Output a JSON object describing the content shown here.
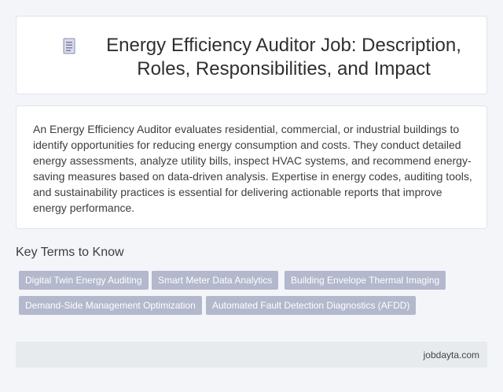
{
  "header": {
    "icon": "document-icon",
    "title": "Energy Efficiency Auditor Job: Description, Roles, Responsibilities, and Impact"
  },
  "description": "An Energy Efficiency Auditor evaluates residential, commercial, or industrial buildings to identify opportunities for reducing energy consumption and costs. They conduct detailed energy assessments, analyze utility bills, inspect HVAC systems, and recommend energy-saving measures based on data-driven analysis. Expertise in energy codes, auditing tools, and sustainability practices is essential for delivering actionable reports that improve energy performance.",
  "key_terms": {
    "heading": "Key Terms to Know",
    "tags": [
      "Digital Twin Energy Auditing",
      "Smart Meter Data Analytics",
      "Building Envelope Thermal Imaging",
      "Demand-Side Management Optimization",
      "Automated Fault Detection Diagnostics (AFDD)"
    ]
  },
  "footer": {
    "site": "jobdayta.com"
  },
  "colors": {
    "tag_bg": "#b3b8cc",
    "footer_bg": "#e7ebee",
    "page_bg": "#f3f5f9"
  }
}
